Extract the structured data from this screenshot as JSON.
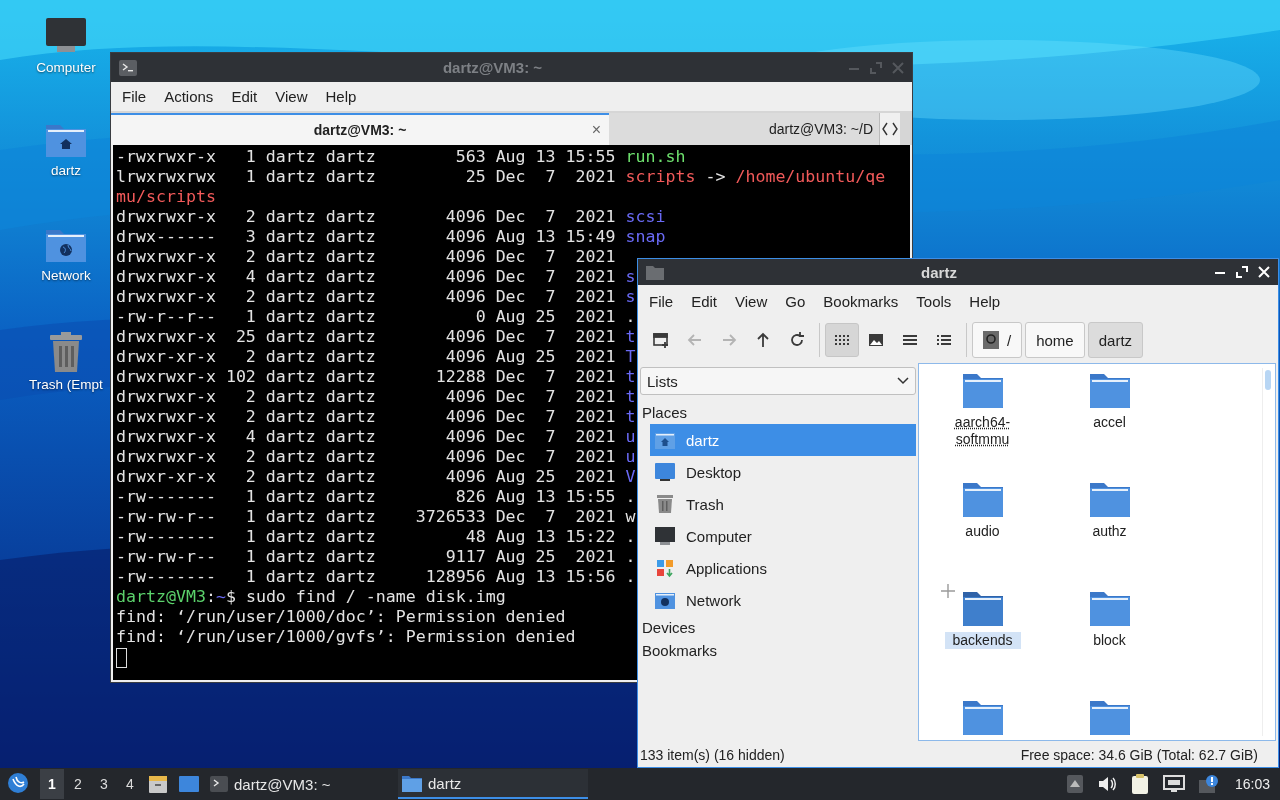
{
  "desktop_icons": [
    {
      "label": "Computer",
      "kind": "computer"
    },
    {
      "label": "dartz",
      "kind": "home"
    },
    {
      "label": "Network",
      "kind": "network"
    },
    {
      "label": "Trash (Empt",
      "kind": "trash"
    }
  ],
  "terminal": {
    "title": "dartz@VM3: ~",
    "menu": [
      "File",
      "Actions",
      "Edit",
      "View",
      "Help"
    ],
    "tabs": [
      {
        "label": "dartz@VM3: ~",
        "selected": true,
        "close": "×"
      },
      {
        "label": "dartz@VM3: ~/D",
        "selected": false
      }
    ],
    "lines": [
      {
        "kind": "text",
        "segs": [
          {
            "kind": "plain",
            "text": "-rwxrwxr-x   1 dartz dartz        563 Aug 13 15:55 "
          },
          {
            "kind": "exec",
            "text": "run.sh"
          }
        ]
      },
      {
        "kind": "text",
        "segs": [
          {
            "kind": "plain",
            "text": "lrwxrwxrwx   1 dartz dartz         25 Dec  7  2021 "
          },
          {
            "kind": "link",
            "text": "scripts"
          },
          {
            "kind": "plain",
            "text": " -> "
          },
          {
            "kind": "link",
            "text": "/home/ubuntu/qe"
          }
        ]
      },
      {
        "kind": "text",
        "segs": [
          {
            "kind": "link",
            "text": "mu/scripts"
          }
        ]
      },
      {
        "kind": "text",
        "segs": [
          {
            "kind": "plain",
            "text": "drwxrwxr-x   2 dartz dartz       4096 Dec  7  2021 "
          },
          {
            "kind": "dir",
            "text": "scsi"
          }
        ]
      },
      {
        "kind": "text",
        "segs": [
          {
            "kind": "plain",
            "text": "drwx------   3 dartz dartz       4096 Aug 13 15:49 "
          },
          {
            "kind": "dir",
            "text": "snap"
          }
        ]
      },
      {
        "kind": "text",
        "segs": [
          {
            "kind": "plain",
            "text": "drwxrwxr-x   2 dartz dartz       4096 Dec  7  2021"
          }
        ]
      },
      {
        "kind": "text",
        "segs": [
          {
            "kind": "plain",
            "text": "drwxrwxr-x   4 dartz dartz       4096 Dec  7  2021 "
          },
          {
            "kind": "dir",
            "text": "s"
          }
        ]
      },
      {
        "kind": "text",
        "segs": [
          {
            "kind": "plain",
            "text": "drwxrwxr-x   2 dartz dartz       4096 Dec  7  2021 "
          },
          {
            "kind": "dir",
            "text": "s"
          }
        ]
      },
      {
        "kind": "text",
        "segs": [
          {
            "kind": "plain",
            "text": "-rw-r--r--   1 dartz dartz          0 Aug 25  2021 ."
          }
        ]
      },
      {
        "kind": "text",
        "segs": [
          {
            "kind": "plain",
            "text": "drwxrwxr-x  25 dartz dartz       4096 Dec  7  2021 "
          },
          {
            "kind": "dir",
            "text": "t"
          }
        ]
      },
      {
        "kind": "text",
        "segs": [
          {
            "kind": "plain",
            "text": "drwxr-xr-x   2 dartz dartz       4096 Aug 25  2021 "
          },
          {
            "kind": "dir",
            "text": "T"
          }
        ]
      },
      {
        "kind": "text",
        "segs": [
          {
            "kind": "plain",
            "text": "drwxrwxr-x 102 dartz dartz      12288 Dec  7  2021 "
          },
          {
            "kind": "dir",
            "text": "t"
          }
        ]
      },
      {
        "kind": "text",
        "segs": [
          {
            "kind": "plain",
            "text": "drwxrwxr-x   2 dartz dartz       4096 Dec  7  2021 "
          },
          {
            "kind": "dir",
            "text": "t"
          }
        ]
      },
      {
        "kind": "text",
        "segs": [
          {
            "kind": "plain",
            "text": "drwxrwxr-x   2 dartz dartz       4096 Dec  7  2021 "
          },
          {
            "kind": "dir",
            "text": "t"
          }
        ]
      },
      {
        "kind": "text",
        "segs": [
          {
            "kind": "plain",
            "text": "drwxrwxr-x   4 dartz dartz       4096 Dec  7  2021 "
          },
          {
            "kind": "dir",
            "text": "u"
          }
        ]
      },
      {
        "kind": "text",
        "segs": [
          {
            "kind": "plain",
            "text": "drwxrwxr-x   2 dartz dartz       4096 Dec  7  2021 "
          },
          {
            "kind": "dir",
            "text": "u"
          }
        ]
      },
      {
        "kind": "text",
        "segs": [
          {
            "kind": "plain",
            "text": "drwxr-xr-x   2 dartz dartz       4096 Aug 25  2021 "
          },
          {
            "kind": "dir",
            "text": "V"
          }
        ]
      },
      {
        "kind": "text",
        "segs": [
          {
            "kind": "plain",
            "text": "-rw-------   1 dartz dartz        826 Aug 13 15:55 ."
          }
        ]
      },
      {
        "kind": "text",
        "segs": [
          {
            "kind": "plain",
            "text": "-rw-rw-r--   1 dartz dartz    3726533 Dec  7  2021 w"
          }
        ]
      },
      {
        "kind": "text",
        "segs": [
          {
            "kind": "plain",
            "text": "-rw-------   1 dartz dartz         48 Aug 13 15:22 ."
          }
        ]
      },
      {
        "kind": "text",
        "segs": [
          {
            "kind": "plain",
            "text": "-rw-rw-r--   1 dartz dartz       9117 Aug 25  2021 ."
          }
        ]
      },
      {
        "kind": "text",
        "segs": [
          {
            "kind": "plain",
            "text": "-rw-------   1 dartz dartz     128956 Aug 13 15:56 ."
          }
        ]
      },
      {
        "kind": "text",
        "segs": [
          {
            "kind": "user",
            "text": "dartz@VM3"
          },
          {
            "kind": "plain",
            "text": ":"
          },
          {
            "kind": "path",
            "text": "~"
          },
          {
            "kind": "plain",
            "text": "$ sudo find / -name disk.img"
          }
        ]
      },
      {
        "kind": "text",
        "segs": [
          {
            "kind": "plain",
            "text": "find: ‘/run/user/1000/doc’: Permission denied"
          }
        ]
      },
      {
        "kind": "text",
        "segs": [
          {
            "kind": "plain",
            "text": "find: ‘/run/user/1000/gvfs’: Permission denied"
          }
        ]
      },
      {
        "kind": "cursor"
      }
    ]
  },
  "file_manager": {
    "title": "dartz",
    "menu": [
      "File",
      "Edit",
      "View",
      "Go",
      "Bookmarks",
      "Tools",
      "Help"
    ],
    "toolbar": [
      {
        "kind": "new-tab",
        "disabled": false
      },
      {
        "kind": "back",
        "disabled": true
      },
      {
        "kind": "forward",
        "disabled": true
      },
      {
        "kind": "up",
        "disabled": false
      },
      {
        "kind": "reload",
        "disabled": false
      }
    ],
    "view_modes": [
      {
        "kind": "icons",
        "selected": true
      },
      {
        "kind": "thumbnails",
        "selected": false
      },
      {
        "kind": "compact",
        "selected": false
      },
      {
        "kind": "details",
        "selected": false
      }
    ],
    "path": [
      {
        "kind": "root",
        "label": "/",
        "selected": false
      },
      {
        "kind": "dir",
        "label": "home",
        "selected": false
      },
      {
        "kind": "dir",
        "label": "dartz",
        "selected": true
      }
    ],
    "side_mode": "Lists",
    "sections": [
      {
        "heading": "Places",
        "items": [
          {
            "label": "dartz",
            "kind": "home",
            "selected": true
          },
          {
            "label": "Desktop",
            "kind": "desktop",
            "selected": false
          },
          {
            "label": "Trash",
            "kind": "trash",
            "selected": false
          },
          {
            "label": "Computer",
            "kind": "computer",
            "selected": false
          },
          {
            "label": "Applications",
            "kind": "apps",
            "selected": false
          },
          {
            "label": "Network",
            "kind": "network",
            "selected": false
          }
        ]
      },
      {
        "heading": "Devices"
      },
      {
        "heading": "Bookmarks"
      }
    ],
    "files": [
      {
        "name": "aarch64-softmmu",
        "selected": false,
        "focused": true
      },
      {
        "name": "accel",
        "selected": false,
        "focused": false
      },
      {
        "name": "audio",
        "selected": false,
        "focused": false
      },
      {
        "name": "authz",
        "selected": false,
        "focused": false
      },
      {
        "name": "backends",
        "selected": true,
        "focused": false
      },
      {
        "name": "block",
        "selected": false,
        "focused": false
      },
      {
        "selected": false
      },
      {
        "selected": false
      }
    ],
    "status_left": "133 item(s) (16 hidden)",
    "status_right": "Free space: 34.6 GiB (Total: 62.7 GiB)"
  },
  "taskbar": {
    "workspaces": [
      {
        "label": "1",
        "selected": true
      },
      {
        "label": "2",
        "selected": false
      },
      {
        "label": "3",
        "selected": false
      },
      {
        "label": "4",
        "selected": false
      }
    ],
    "tasks": [
      {
        "label": "dartz@VM3: ~",
        "kind": "terminal",
        "selected": false
      },
      {
        "label": "dartz",
        "kind": "folder",
        "selected": true
      }
    ],
    "clock": "16:03"
  }
}
